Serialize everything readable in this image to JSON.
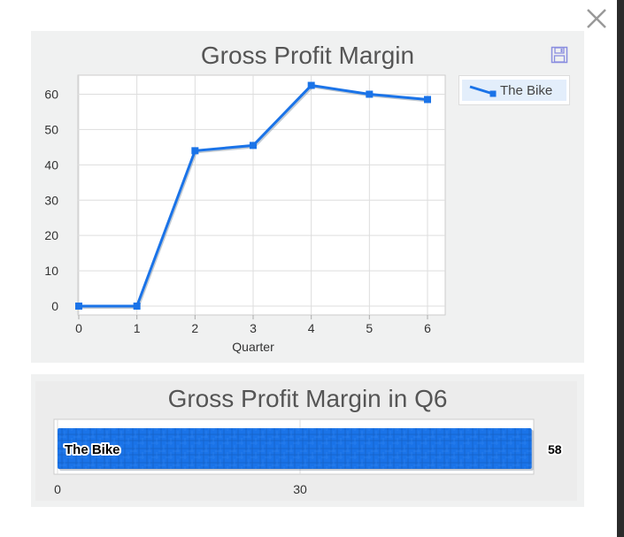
{
  "dialog": {
    "close_label": "×"
  },
  "chart_data": [
    {
      "type": "line",
      "title": "Gross Profit Margin",
      "xlabel": "Quarter",
      "ylabel": "",
      "x": [
        0,
        1,
        2,
        3,
        4,
        5,
        6
      ],
      "xlim": [
        0,
        6
      ],
      "ylim": [
        0,
        65
      ],
      "yticks": [
        0,
        10,
        20,
        30,
        40,
        50,
        60
      ],
      "grid": true,
      "legend_position": "top-right",
      "series": [
        {
          "name": "The Bike",
          "values": [
            0,
            0,
            44,
            45.5,
            62.5,
            60,
            58.5
          ],
          "color": "#1a73e8"
        }
      ]
    },
    {
      "type": "bar",
      "orientation": "horizontal",
      "title": "Gross Profit Margin in Q6",
      "categories": [
        "The Bike"
      ],
      "values": [
        58
      ],
      "value_labels": [
        "58"
      ],
      "xticks": [
        "0",
        "30"
      ],
      "xlim": [
        0,
        60
      ],
      "color": "#1a73e8"
    }
  ]
}
